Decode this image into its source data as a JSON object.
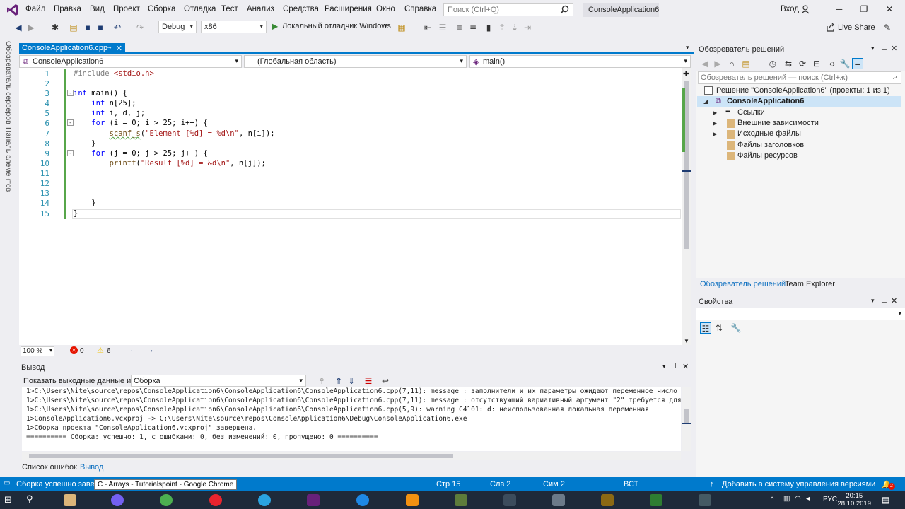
{
  "menu": {
    "items": [
      "Файл",
      "Правка",
      "Вид",
      "Проект",
      "Сборка",
      "Отладка",
      "Тест",
      "Анализ",
      "Средства",
      "Расширения",
      "Окно",
      "Справка"
    ],
    "search_placeholder": "Поиск (Ctrl+Q)",
    "solution_name": "ConsoleApplication6",
    "signin": "Вход"
  },
  "toolbar": {
    "config": "Debug",
    "platform": "x86",
    "debugger": "Локальный отладчик Windows",
    "live_share": "Live Share"
  },
  "sidebar": {
    "server_explorer": "Обозреватель серверов",
    "toolbox": "Панель элементов"
  },
  "editor": {
    "tab_title": "ConsoleApplication6.cpp",
    "nav_project": "ConsoleApplication6",
    "nav_scope": "(Глобальная область)",
    "nav_member": "main()",
    "line_numbers": [
      "1",
      "2",
      "3",
      "4",
      "5",
      "6",
      "7",
      "8",
      "9",
      "10",
      "11",
      "12",
      "13",
      "14",
      "15"
    ],
    "zoom": "100 %",
    "errors": "0",
    "warnings": "6"
  },
  "output": {
    "title": "Вывод",
    "show_from_label": "Показать выходные данные из:",
    "show_from_value": "Сборка",
    "lines": [
      "1>C:\\Users\\Nite\\source\\repos\\ConsoleApplication6\\ConsoleApplication6\\ConsoleApplication6.cpp(7,11): message : заполнители и их параметры ожидают переменное число аргументов в",
      "1>C:\\Users\\Nite\\source\\repos\\ConsoleApplication6\\ConsoleApplication6\\ConsoleApplication6.cpp(7,11): message : отсутствующий вариативный аргумент \"2\" требуется для строки форм",
      "1>C:\\Users\\Nite\\source\\repos\\ConsoleApplication6\\ConsoleApplication6\\ConsoleApplication6.cpp(5,9): warning C4101: d: неиспользованная локальная переменная",
      "1>ConsoleApplication6.vcxproj -> C:\\Users\\Nite\\source\\repos\\ConsoleApplication6\\Debug\\ConsoleApplication6.exe",
      "1>Сборка проекта \"ConsoleApplication6.vcxproj\" завершена.",
      "========== Сборка: успешно: 1, с ошибками: 0, без изменений: 0, пропущено: 0 =========="
    ]
  },
  "bottom_tabs": {
    "errors": "Список ошибок",
    "output": "Вывод"
  },
  "solution_explorer": {
    "title": "Обозреватель решений",
    "search_placeholder": "Обозреватель решений — поиск (Ctrl+ж)",
    "solution_node": "Решение \"ConsoleApplication6\" (проекты: 1 из 1)",
    "project_node": "ConsoleApplication6",
    "items": [
      "Ссылки",
      "Внешние зависимости",
      "Исходные файлы",
      "Файлы заголовков",
      "Файлы ресурсов"
    ],
    "tab_solution": "Обозреватель решений",
    "tab_team": "Team Explorer"
  },
  "properties": {
    "title": "Свойства"
  },
  "statusbar": {
    "message": "Сборка успешно заверш",
    "line": "Стр 15",
    "col": "Слв 2",
    "char": "Сим 2",
    "mode": "ВСТ",
    "source_control": "Добавить в систему управления версиями",
    "notifications": "2"
  },
  "tooltip": "C - Arrays - Tutorialspoint - Google Chrome",
  "taskbar": {
    "lang": "РУС",
    "time": "20:15",
    "date": "28.10.2019"
  },
  "colors": {
    "accent": "#007acc",
    "vs_purple": "#68217a",
    "gutter_green": "#57a64a"
  }
}
